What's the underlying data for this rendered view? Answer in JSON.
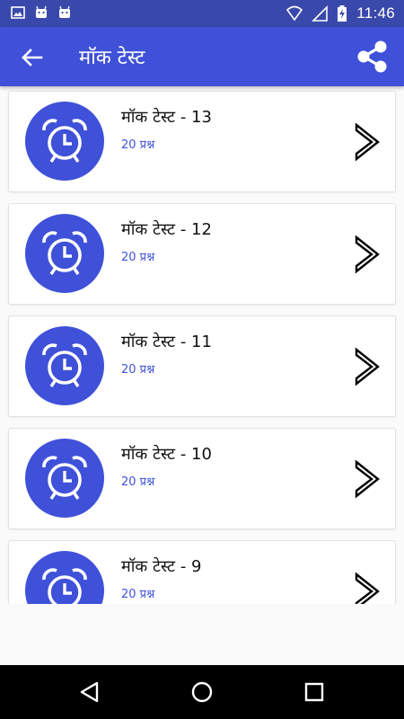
{
  "status_bar": {
    "time": "11:46",
    "left_icons": [
      "image-icon",
      "android-icon",
      "android-icon"
    ],
    "right_icons": [
      "wifi-icon",
      "signal-icon",
      "battery-charging-icon"
    ]
  },
  "app_bar": {
    "title": "मॉक टेस्ट",
    "back_icon": "arrow-left-icon",
    "share_icon": "share-icon",
    "color": "#3f51d8"
  },
  "tests": [
    {
      "title": "मॉक टेस्ट - 13",
      "subtitle": "20 प्रश्न"
    },
    {
      "title": "मॉक टेस्ट - 12",
      "subtitle": "20 प्रश्न"
    },
    {
      "title": "मॉक टेस्ट - 11",
      "subtitle": "20 प्रश्न"
    },
    {
      "title": "मॉक टेस्ट - 10",
      "subtitle": "20 प्रश्न"
    },
    {
      "title": "मॉक टेस्ट - 9",
      "subtitle": "20 प्रश्न"
    }
  ],
  "item_icon": "alarm-clock-icon",
  "nav_bar": {
    "icons": [
      "back-triangle-icon",
      "home-circle-icon",
      "recents-square-icon"
    ]
  }
}
